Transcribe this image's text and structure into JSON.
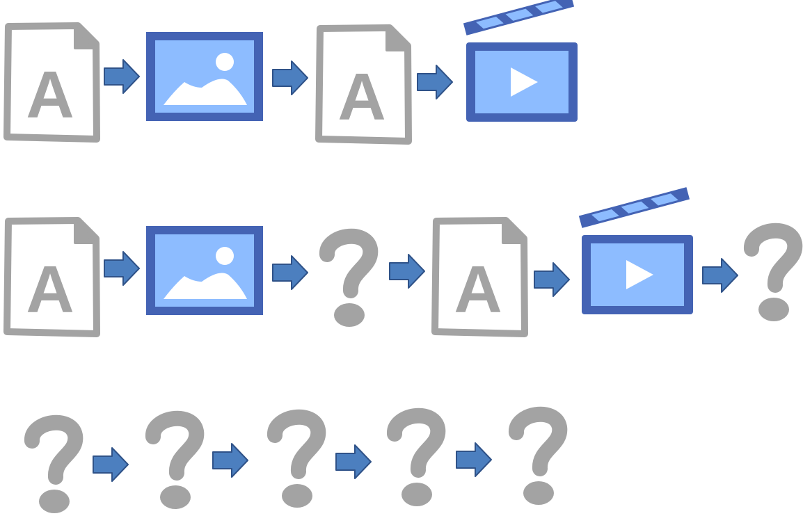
{
  "colors": {
    "gray": "#a3a3a3",
    "blue_dark": "#4463b4",
    "blue_light": "#8dbcff",
    "arrow_fill": "#4c7fbf",
    "arrow_stroke": "#2f5288",
    "white": "#ffffff"
  },
  "icons": {
    "text": {
      "name": "text-document-icon",
      "letter": "A"
    },
    "image": {
      "name": "image-icon"
    },
    "video": {
      "name": "video-clapperboard-icon"
    },
    "unknown": {
      "name": "question-mark-icon"
    },
    "arrow": {
      "name": "right-arrow-icon"
    }
  },
  "rows": [
    {
      "name": "sequence-row-1",
      "items": [
        "text",
        "image",
        "text",
        "video"
      ]
    },
    {
      "name": "sequence-row-2",
      "items": [
        "text",
        "image",
        "unknown",
        "text",
        "video",
        "unknown"
      ]
    },
    {
      "name": "sequence-row-3",
      "items": [
        "unknown",
        "unknown",
        "unknown",
        "unknown",
        "unknown"
      ]
    }
  ]
}
